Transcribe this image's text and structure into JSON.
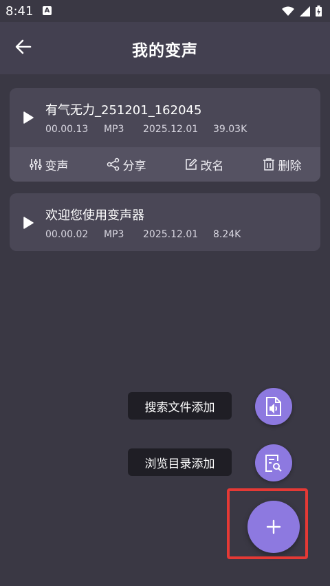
{
  "status": {
    "time": "8:41",
    "notification_letter": "A"
  },
  "header": {
    "title": "我的变声"
  },
  "recordings": [
    {
      "name": "有气无力_251201_162045",
      "duration": "00.00.13",
      "format": "MP3",
      "date": "2025.12.01",
      "size": "39.03K",
      "actions": {
        "voice": "变声",
        "share": "分享",
        "rename": "改名",
        "delete": "删除"
      }
    },
    {
      "name": "欢迎您使用变声器",
      "duration": "00.00.02",
      "format": "MP3",
      "date": "2025.12.01",
      "size": "8.24K"
    }
  ],
  "fab_menu": {
    "search_files": "搜索文件添加",
    "browse_dir": "浏览目录添加"
  },
  "colors": {
    "accent": "#8d79e0",
    "highlight": "#e53935"
  }
}
